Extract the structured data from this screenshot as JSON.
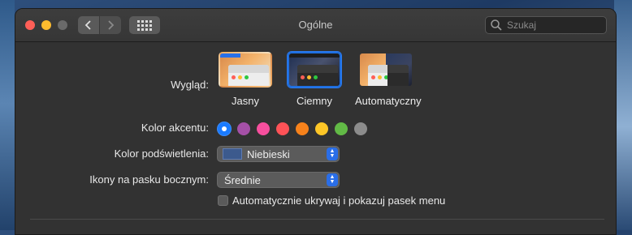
{
  "window": {
    "title": "Ogólne"
  },
  "toolbar": {
    "back_icon": "chevron-left-icon",
    "forward_icon": "chevron-right-icon",
    "grid_icon": "grid-icon"
  },
  "search": {
    "placeholder": "Szukaj",
    "value": ""
  },
  "appearance": {
    "label": "Wygląd:",
    "options": [
      {
        "name": "Jasny",
        "selected": false
      },
      {
        "name": "Ciemny",
        "selected": true
      },
      {
        "name": "Automatyczny",
        "selected": false
      }
    ]
  },
  "accent": {
    "label": "Kolor akcentu:",
    "colors": [
      {
        "name": "blue",
        "hex": "#1a7bff",
        "selected": true
      },
      {
        "name": "purple",
        "hex": "#a550a7"
      },
      {
        "name": "pink",
        "hex": "#f74f9e"
      },
      {
        "name": "red",
        "hex": "#ff5257"
      },
      {
        "name": "orange",
        "hex": "#f7821b"
      },
      {
        "name": "yellow",
        "hex": "#fec627"
      },
      {
        "name": "green",
        "hex": "#62ba46"
      },
      {
        "name": "graphite",
        "hex": "#8c8c8c"
      }
    ]
  },
  "highlight": {
    "label": "Kolor podświetlenia:",
    "value": "Niebieski",
    "swatch": "#3c5a8d"
  },
  "sidebar_icons": {
    "label": "Ikony na pasku bocznym:",
    "value": "Średnie"
  },
  "menubar_autohide": {
    "label": "Automatycznie ukrywaj i pokazuj pasek menu",
    "checked": false
  }
}
